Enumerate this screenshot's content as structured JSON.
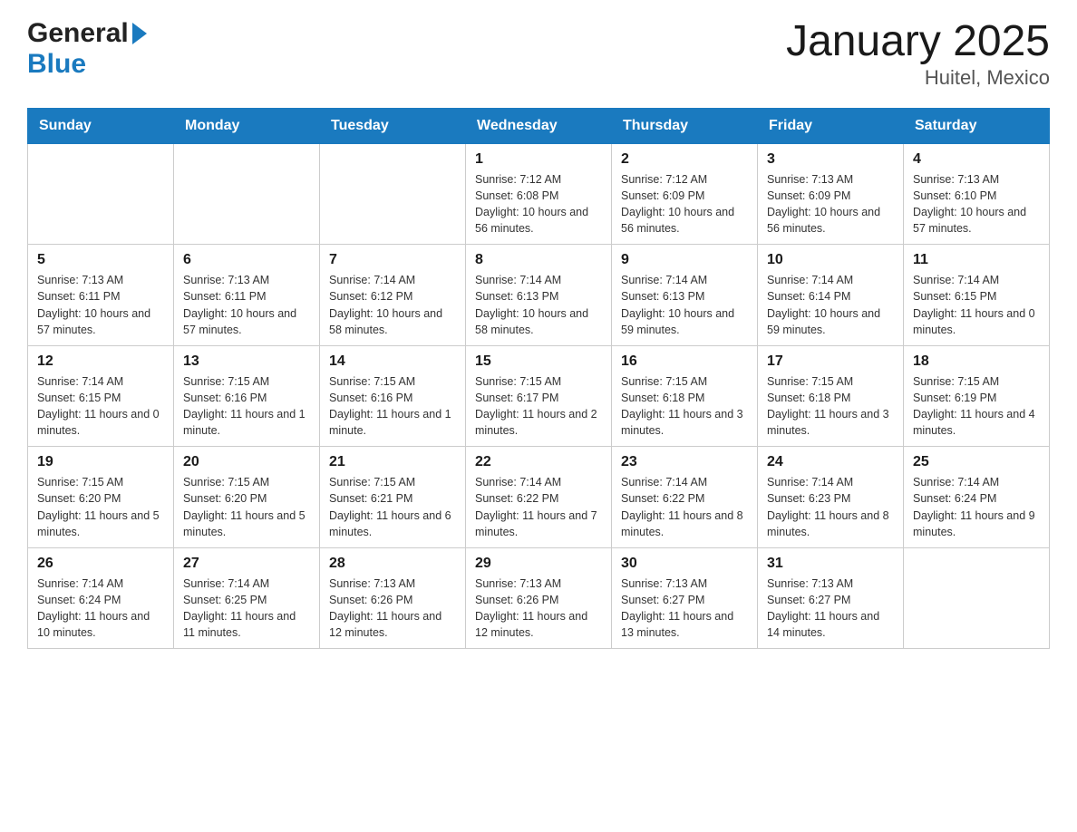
{
  "header": {
    "logo_general": "General",
    "logo_blue": "Blue",
    "title": "January 2025",
    "subtitle": "Huitel, Mexico"
  },
  "days_of_week": [
    "Sunday",
    "Monday",
    "Tuesday",
    "Wednesday",
    "Thursday",
    "Friday",
    "Saturday"
  ],
  "weeks": [
    [
      {
        "day": "",
        "info": ""
      },
      {
        "day": "",
        "info": ""
      },
      {
        "day": "",
        "info": ""
      },
      {
        "day": "1",
        "info": "Sunrise: 7:12 AM\nSunset: 6:08 PM\nDaylight: 10 hours and 56 minutes."
      },
      {
        "day": "2",
        "info": "Sunrise: 7:12 AM\nSunset: 6:09 PM\nDaylight: 10 hours and 56 minutes."
      },
      {
        "day": "3",
        "info": "Sunrise: 7:13 AM\nSunset: 6:09 PM\nDaylight: 10 hours and 56 minutes."
      },
      {
        "day": "4",
        "info": "Sunrise: 7:13 AM\nSunset: 6:10 PM\nDaylight: 10 hours and 57 minutes."
      }
    ],
    [
      {
        "day": "5",
        "info": "Sunrise: 7:13 AM\nSunset: 6:11 PM\nDaylight: 10 hours and 57 minutes."
      },
      {
        "day": "6",
        "info": "Sunrise: 7:13 AM\nSunset: 6:11 PM\nDaylight: 10 hours and 57 minutes."
      },
      {
        "day": "7",
        "info": "Sunrise: 7:14 AM\nSunset: 6:12 PM\nDaylight: 10 hours and 58 minutes."
      },
      {
        "day": "8",
        "info": "Sunrise: 7:14 AM\nSunset: 6:13 PM\nDaylight: 10 hours and 58 minutes."
      },
      {
        "day": "9",
        "info": "Sunrise: 7:14 AM\nSunset: 6:13 PM\nDaylight: 10 hours and 59 minutes."
      },
      {
        "day": "10",
        "info": "Sunrise: 7:14 AM\nSunset: 6:14 PM\nDaylight: 10 hours and 59 minutes."
      },
      {
        "day": "11",
        "info": "Sunrise: 7:14 AM\nSunset: 6:15 PM\nDaylight: 11 hours and 0 minutes."
      }
    ],
    [
      {
        "day": "12",
        "info": "Sunrise: 7:14 AM\nSunset: 6:15 PM\nDaylight: 11 hours and 0 minutes."
      },
      {
        "day": "13",
        "info": "Sunrise: 7:15 AM\nSunset: 6:16 PM\nDaylight: 11 hours and 1 minute."
      },
      {
        "day": "14",
        "info": "Sunrise: 7:15 AM\nSunset: 6:16 PM\nDaylight: 11 hours and 1 minute."
      },
      {
        "day": "15",
        "info": "Sunrise: 7:15 AM\nSunset: 6:17 PM\nDaylight: 11 hours and 2 minutes."
      },
      {
        "day": "16",
        "info": "Sunrise: 7:15 AM\nSunset: 6:18 PM\nDaylight: 11 hours and 3 minutes."
      },
      {
        "day": "17",
        "info": "Sunrise: 7:15 AM\nSunset: 6:18 PM\nDaylight: 11 hours and 3 minutes."
      },
      {
        "day": "18",
        "info": "Sunrise: 7:15 AM\nSunset: 6:19 PM\nDaylight: 11 hours and 4 minutes."
      }
    ],
    [
      {
        "day": "19",
        "info": "Sunrise: 7:15 AM\nSunset: 6:20 PM\nDaylight: 11 hours and 5 minutes."
      },
      {
        "day": "20",
        "info": "Sunrise: 7:15 AM\nSunset: 6:20 PM\nDaylight: 11 hours and 5 minutes."
      },
      {
        "day": "21",
        "info": "Sunrise: 7:15 AM\nSunset: 6:21 PM\nDaylight: 11 hours and 6 minutes."
      },
      {
        "day": "22",
        "info": "Sunrise: 7:14 AM\nSunset: 6:22 PM\nDaylight: 11 hours and 7 minutes."
      },
      {
        "day": "23",
        "info": "Sunrise: 7:14 AM\nSunset: 6:22 PM\nDaylight: 11 hours and 8 minutes."
      },
      {
        "day": "24",
        "info": "Sunrise: 7:14 AM\nSunset: 6:23 PM\nDaylight: 11 hours and 8 minutes."
      },
      {
        "day": "25",
        "info": "Sunrise: 7:14 AM\nSunset: 6:24 PM\nDaylight: 11 hours and 9 minutes."
      }
    ],
    [
      {
        "day": "26",
        "info": "Sunrise: 7:14 AM\nSunset: 6:24 PM\nDaylight: 11 hours and 10 minutes."
      },
      {
        "day": "27",
        "info": "Sunrise: 7:14 AM\nSunset: 6:25 PM\nDaylight: 11 hours and 11 minutes."
      },
      {
        "day": "28",
        "info": "Sunrise: 7:13 AM\nSunset: 6:26 PM\nDaylight: 11 hours and 12 minutes."
      },
      {
        "day": "29",
        "info": "Sunrise: 7:13 AM\nSunset: 6:26 PM\nDaylight: 11 hours and 12 minutes."
      },
      {
        "day": "30",
        "info": "Sunrise: 7:13 AM\nSunset: 6:27 PM\nDaylight: 11 hours and 13 minutes."
      },
      {
        "day": "31",
        "info": "Sunrise: 7:13 AM\nSunset: 6:27 PM\nDaylight: 11 hours and 14 minutes."
      },
      {
        "day": "",
        "info": ""
      }
    ]
  ]
}
